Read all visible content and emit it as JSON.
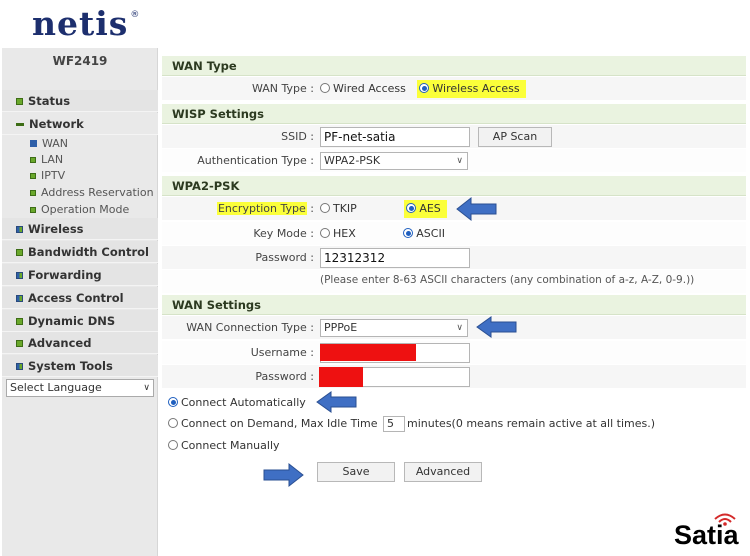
{
  "brand": {
    "logo": "netis",
    "trademark": "®",
    "model": "WF2419",
    "watermark": "Satia"
  },
  "sidebar": {
    "items": [
      {
        "label": "Status",
        "icon": "green-square-icon"
      },
      {
        "label": "Network",
        "icon": "collapse-minus-icon"
      },
      {
        "label": "Wireless",
        "icon": "grid-icon"
      },
      {
        "label": "Bandwidth Control",
        "icon": "green-square-icon"
      },
      {
        "label": "Forwarding",
        "icon": "grid-icon"
      },
      {
        "label": "Access Control",
        "icon": "grid-icon"
      },
      {
        "label": "Dynamic DNS",
        "icon": "green-square-icon"
      },
      {
        "label": "Advanced",
        "icon": "green-square-icon"
      },
      {
        "label": "System Tools",
        "icon": "grid-icon"
      }
    ],
    "network_sub": [
      "WAN",
      "LAN",
      "IPTV",
      "Address Reservation",
      "Operation Mode"
    ],
    "language": "Select Language"
  },
  "wan_type": {
    "section": "WAN Type",
    "label": "WAN Type :",
    "options": [
      "Wired Access",
      "Wireless Access"
    ],
    "selected": "Wireless Access"
  },
  "wisp": {
    "section": "WISP Settings",
    "ssid_label": "SSID :",
    "ssid": "PF-net-satia",
    "ap_scan": "AP Scan",
    "auth_label": "Authentication Type :",
    "auth": "WPA2-PSK"
  },
  "wpa2": {
    "section": "WPA2-PSK",
    "enc_label": "Encryption Type",
    "enc_colon": ":",
    "enc_options": [
      "TKIP",
      "AES"
    ],
    "enc_selected": "AES",
    "key_label": "Key Mode :",
    "key_options": [
      "HEX",
      "ASCII"
    ],
    "key_selected": "ASCII",
    "pw_label": "Password :",
    "password": "12312312",
    "hint": "(Please enter 8-63 ASCII characters (any combination of a-z, A-Z, 0-9.))"
  },
  "wan_settings": {
    "section": "WAN Settings",
    "conn_type_label": "WAN Connection Type :",
    "conn_type": "PPPoE",
    "username_label": "Username :",
    "password_label": "Password :",
    "auto": "Connect Automatically",
    "demand_prefix": "Connect on Demand, Max Idle Time",
    "idle_time": "5",
    "demand_suffix": "minutes(0 means remain active at all times.)",
    "manual": "Connect Manually",
    "selected_mode": "Connect Automatically",
    "save": "Save",
    "advanced": "Advanced"
  },
  "colors": {
    "highlight": "#fbff3a",
    "arrow": "#3f6fc4",
    "redaction": "#ee1111",
    "logo": "#1d2f6e"
  }
}
